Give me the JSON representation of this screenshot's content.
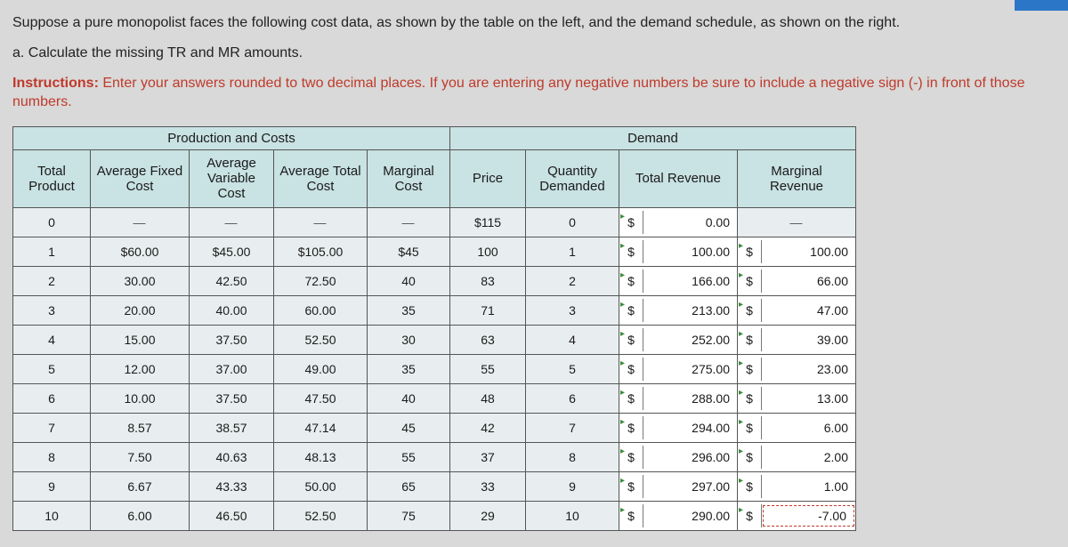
{
  "text": {
    "intro": "Suppose a pure monopolist faces the following cost data, as shown by the table on the left, and the demand schedule, as shown on the right.",
    "part_a": "a. Calculate the missing TR and MR amounts.",
    "instructions_label": "Instructions:",
    "instructions_body": " Enter your answers rounded to two decimal places. If you are entering any negative numbers be sure to include a negative sign (-) in front of those numbers."
  },
  "sections": {
    "prod": "Production and Costs",
    "demand": "Demand"
  },
  "headers": {
    "tp": "Total Product",
    "afc": "Average Fixed Cost",
    "avc": "Average Variable Cost",
    "atc": "Average Total Cost",
    "mc": "Marginal Cost",
    "price": "Price",
    "qd": "Quantity Demanded",
    "tr": "Total Revenue",
    "mr": "Marginal Revenue"
  },
  "dash": "—",
  "dollar": "$",
  "rows": [
    {
      "tp": "0",
      "afc": "—",
      "avc": "—",
      "atc": "—",
      "mc": "—",
      "price": "$115",
      "qd": "0",
      "tr": "0.00",
      "mr": "—"
    },
    {
      "tp": "1",
      "afc": "$60.00",
      "avc": "$45.00",
      "atc": "$105.00",
      "mc": "$45",
      "price": "100",
      "qd": "1",
      "tr": "100.00",
      "mr": "100.00"
    },
    {
      "tp": "2",
      "afc": "30.00",
      "avc": "42.50",
      "atc": "72.50",
      "mc": "40",
      "price": "83",
      "qd": "2",
      "tr": "166.00",
      "mr": "66.00"
    },
    {
      "tp": "3",
      "afc": "20.00",
      "avc": "40.00",
      "atc": "60.00",
      "mc": "35",
      "price": "71",
      "qd": "3",
      "tr": "213.00",
      "mr": "47.00"
    },
    {
      "tp": "4",
      "afc": "15.00",
      "avc": "37.50",
      "atc": "52.50",
      "mc": "30",
      "price": "63",
      "qd": "4",
      "tr": "252.00",
      "mr": "39.00"
    },
    {
      "tp": "5",
      "afc": "12.00",
      "avc": "37.00",
      "atc": "49.00",
      "mc": "35",
      "price": "55",
      "qd": "5",
      "tr": "275.00",
      "mr": "23.00"
    },
    {
      "tp": "6",
      "afc": "10.00",
      "avc": "37.50",
      "atc": "47.50",
      "mc": "40",
      "price": "48",
      "qd": "6",
      "tr": "288.00",
      "mr": "13.00"
    },
    {
      "tp": "7",
      "afc": "8.57",
      "avc": "38.57",
      "atc": "47.14",
      "mc": "45",
      "price": "42",
      "qd": "7",
      "tr": "294.00",
      "mr": "6.00"
    },
    {
      "tp": "8",
      "afc": "7.50",
      "avc": "40.63",
      "atc": "48.13",
      "mc": "55",
      "price": "37",
      "qd": "8",
      "tr": "296.00",
      "mr": "2.00"
    },
    {
      "tp": "9",
      "afc": "6.67",
      "avc": "43.33",
      "atc": "50.00",
      "mc": "65",
      "price": "33",
      "qd": "9",
      "tr": "297.00",
      "mr": "1.00"
    },
    {
      "tp": "10",
      "afc": "6.00",
      "avc": "46.50",
      "atc": "52.50",
      "mc": "75",
      "price": "29",
      "qd": "10",
      "tr": "290.00",
      "mr": "-7.00"
    }
  ],
  "chart_data": {
    "type": "table",
    "title": "Monopolist cost and demand data",
    "columns": [
      "Total Product",
      "Average Fixed Cost",
      "Average Variable Cost",
      "Average Total Cost",
      "Marginal Cost",
      "Price",
      "Quantity Demanded",
      "Total Revenue",
      "Marginal Revenue"
    ],
    "data": [
      [
        0,
        null,
        null,
        null,
        null,
        115,
        0,
        0.0,
        null
      ],
      [
        1,
        60.0,
        45.0,
        105.0,
        45,
        100,
        1,
        100.0,
        100.0
      ],
      [
        2,
        30.0,
        42.5,
        72.5,
        40,
        83,
        2,
        166.0,
        66.0
      ],
      [
        3,
        20.0,
        40.0,
        60.0,
        35,
        71,
        3,
        213.0,
        47.0
      ],
      [
        4,
        15.0,
        37.5,
        52.5,
        30,
        63,
        4,
        252.0,
        39.0
      ],
      [
        5,
        12.0,
        37.0,
        49.0,
        35,
        55,
        5,
        275.0,
        23.0
      ],
      [
        6,
        10.0,
        37.5,
        47.5,
        40,
        48,
        6,
        288.0,
        13.0
      ],
      [
        7,
        8.57,
        38.57,
        47.14,
        45,
        42,
        7,
        294.0,
        6.0
      ],
      [
        8,
        7.5,
        40.63,
        48.13,
        55,
        37,
        8,
        296.0,
        2.0
      ],
      [
        9,
        6.67,
        43.33,
        50.0,
        65,
        33,
        9,
        297.0,
        1.0
      ],
      [
        10,
        6.0,
        46.5,
        52.5,
        75,
        29,
        10,
        290.0,
        -7.0
      ]
    ]
  }
}
